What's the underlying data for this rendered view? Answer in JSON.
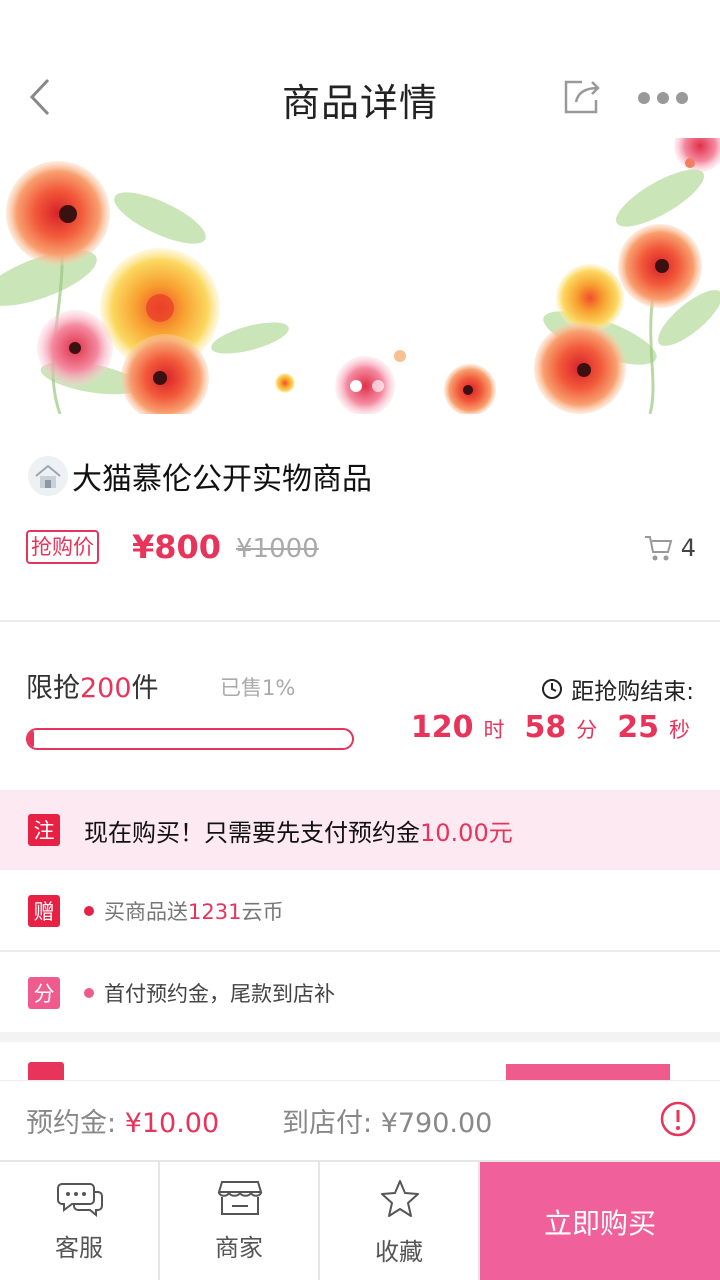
{
  "nav": {
    "title": "商品详情",
    "back_icon": "chevron-left-icon",
    "share_icon": "share-icon",
    "more_icon": "more-dots-icon"
  },
  "banner": {
    "image": "watercolor-flowers",
    "page_count": 2,
    "active_page": 1
  },
  "product": {
    "title": "大猫慕伦公开实物商品",
    "price_tag": "抢购价",
    "price_now": "¥800",
    "price_old": "¥1000",
    "cart_count": "4"
  },
  "flash_sale": {
    "limit_prefix": "限抢",
    "limit_count": "200",
    "limit_suffix": "件",
    "sold_text": "已售1%",
    "sold_fraction": 0.01,
    "countdown_label": "距抢购结束:",
    "hours": "120",
    "hours_unit": "时",
    "minutes": "58",
    "minutes_unit": "分",
    "seconds": "25",
    "seconds_unit": "秒"
  },
  "notice": {
    "badge": "注",
    "text": "现在购买！只需要先支付预约金",
    "amount": "10.00元"
  },
  "promos": [
    {
      "badge": "赠",
      "prefix": "买商品送",
      "highlight": "1231",
      "suffix": "云币"
    },
    {
      "badge": "分",
      "prefix": "首付预约金，尾款到店补",
      "highlight": "",
      "suffix": ""
    }
  ],
  "deposit": {
    "deposit_label": "预约金: ",
    "deposit_value": "¥10.00",
    "store_label": "到店付: ",
    "store_value": "¥790.00"
  },
  "tabbar": {
    "service": "客服",
    "merchant": "商家",
    "favorite": "收藏",
    "buy": "立即购买"
  },
  "colors": {
    "accent": "#e8335a",
    "buy_button": "#f0609a",
    "notice_bg": "#fde9f1"
  }
}
